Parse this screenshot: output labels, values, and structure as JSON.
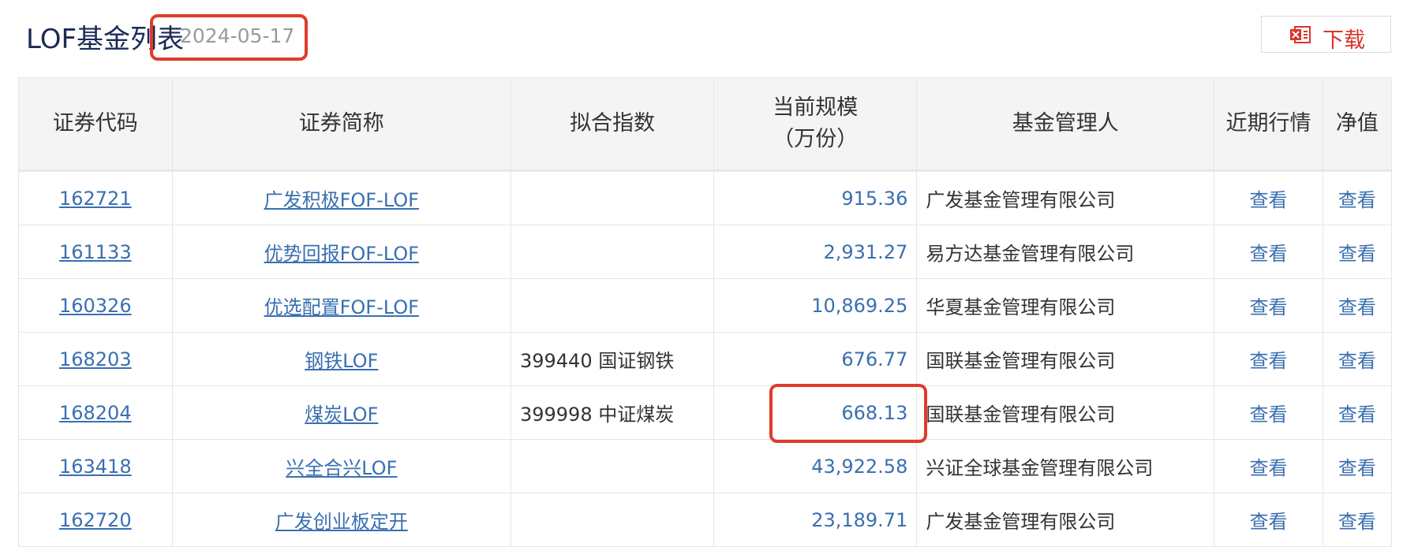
{
  "header": {
    "title": "LOF基金列表",
    "date": "2024-05-17",
    "download_label": "下载",
    "download_icon": "excel-download-icon"
  },
  "table": {
    "columns": [
      "证券代码",
      "证券简称",
      "拟合指数",
      "当前规模",
      "（万份）",
      "基金管理人",
      "近期行情",
      "净值"
    ],
    "rows": [
      {
        "code": "162721",
        "name": "广发积极FOF-LOF",
        "index": "",
        "scale": "915.36",
        "manager": "广发基金管理有限公司",
        "quote": "查看",
        "nav": "查看"
      },
      {
        "code": "161133",
        "name": "优势回报FOF-LOF",
        "index": "",
        "scale": "2,931.27",
        "manager": "易方达基金管理有限公司",
        "quote": "查看",
        "nav": "查看"
      },
      {
        "code": "160326",
        "name": "优选配置FOF-LOF",
        "index": "",
        "scale": "10,869.25",
        "manager": "华夏基金管理有限公司",
        "quote": "查看",
        "nav": "查看"
      },
      {
        "code": "168203",
        "name": "钢铁LOF",
        "index": "399440 国证钢铁",
        "scale": "676.77",
        "manager": "国联基金管理有限公司",
        "quote": "查看",
        "nav": "查看"
      },
      {
        "code": "168204",
        "name": "煤炭LOF",
        "index": "399998 中证煤炭",
        "scale": "668.13",
        "manager": "国联基金管理有限公司",
        "quote": "查看",
        "nav": "查看"
      },
      {
        "code": "163418",
        "name": "兴全合兴LOF",
        "index": "",
        "scale": "43,922.58",
        "manager": "兴证全球基金管理有限公司",
        "quote": "查看",
        "nav": "查看"
      },
      {
        "code": "162720",
        "name": "广发创业板定开",
        "index": "",
        "scale": "23,189.71",
        "manager": "广发基金管理有限公司",
        "quote": "查看",
        "nav": "查看"
      }
    ]
  },
  "colors": {
    "link": "#3a6fb0",
    "highlight": "#e03b2a",
    "download": "#d9342b",
    "title": "#1b2a57"
  }
}
